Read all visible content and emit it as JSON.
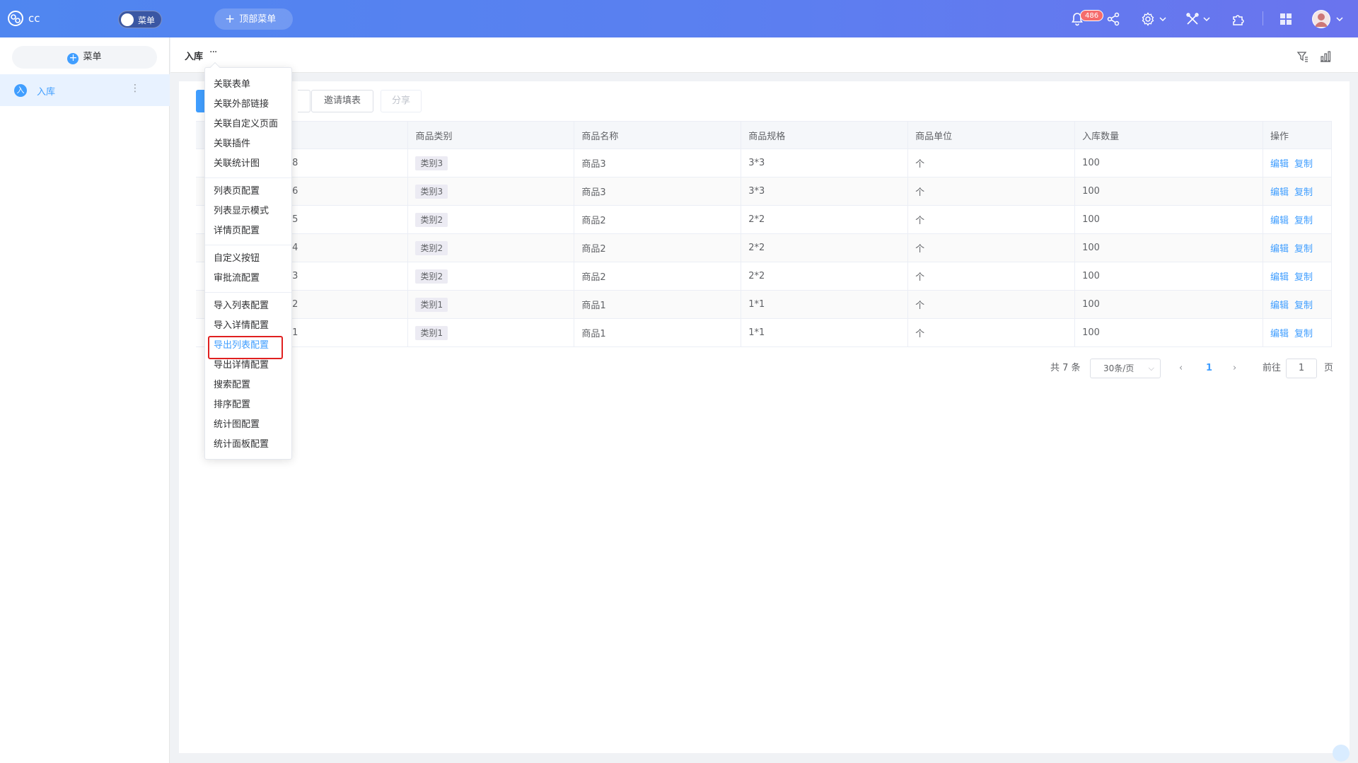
{
  "app": {
    "name": "cc"
  },
  "topbar": {
    "menu_toggle_label": "菜单",
    "top_menu_label": "顶部菜单",
    "notification_count": "486",
    "icons": [
      "bell-icon",
      "share-icon",
      "gear-icon",
      "tools-icon",
      "puzzle-icon",
      "grid-icon",
      "avatar"
    ]
  },
  "sidebar": {
    "add_label": "菜单",
    "items": [
      {
        "avatar": "入",
        "label": "入库"
      }
    ]
  },
  "page": {
    "title": "入库",
    "more": "···"
  },
  "toolbar": {
    "invite_label": "邀请填表",
    "share_label": "分享"
  },
  "table": {
    "headers": [
      "",
      "商品类别",
      "商品名称",
      "商品规格",
      "商品单位",
      "入库数量",
      "操作"
    ],
    "rows": [
      {
        "id": "08",
        "category": "类别3",
        "name": "商品3",
        "spec": "3*3",
        "unit": "个",
        "qty": "100"
      },
      {
        "id": "06",
        "category": "类别3",
        "name": "商品3",
        "spec": "3*3",
        "unit": "个",
        "qty": "100"
      },
      {
        "id": "05",
        "category": "类别2",
        "name": "商品2",
        "spec": "2*2",
        "unit": "个",
        "qty": "100"
      },
      {
        "id": "04",
        "category": "类别2",
        "name": "商品2",
        "spec": "2*2",
        "unit": "个",
        "qty": "100"
      },
      {
        "id": "03",
        "category": "类别2",
        "name": "商品2",
        "spec": "2*2",
        "unit": "个",
        "qty": "100"
      },
      {
        "id": "02",
        "category": "类别1",
        "name": "商品1",
        "spec": "1*1",
        "unit": "个",
        "qty": "100"
      },
      {
        "id": "01",
        "category": "类别1",
        "name": "商品1",
        "spec": "1*1",
        "unit": "个",
        "qty": "100"
      }
    ],
    "actions": {
      "edit": "编辑",
      "copy": "复制"
    }
  },
  "pagination": {
    "total": "共 7 条",
    "page_size": "30条/页",
    "current": "1",
    "jump_prefix": "前往",
    "jump_value": "1",
    "jump_suffix": "页"
  },
  "dropdown": {
    "groups": [
      [
        "关联表单",
        "关联外部链接",
        "关联自定义页面",
        "关联插件",
        "关联统计图"
      ],
      [
        "列表页配置",
        "列表显示模式",
        "详情页配置"
      ],
      [
        "自定义按钮",
        "审批流配置"
      ],
      [
        "导入列表配置",
        "导入详情配置",
        "导出列表配置",
        "导出详情配置",
        "搜索配置",
        "排序配置",
        "统计图配置",
        "统计面板配置"
      ]
    ],
    "highlighted": "导出列表配置"
  },
  "colors": {
    "primary": "#409eff",
    "topbar_start": "#4f86f0",
    "topbar_end": "#6a74ee",
    "highlight_border": "#e02020",
    "badge": "#f56c6c"
  }
}
